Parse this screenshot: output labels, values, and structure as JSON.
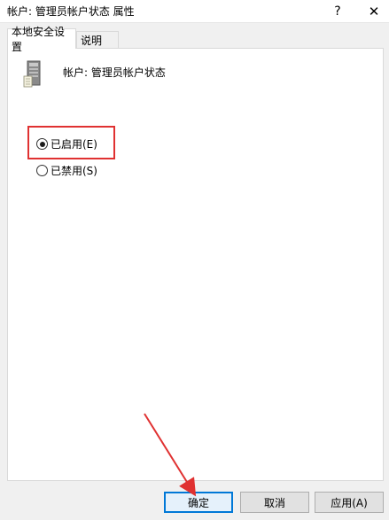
{
  "window": {
    "title": "帐户: 管理员帐户状态 属性",
    "help_label": "?",
    "close_label": "✕"
  },
  "tabs": [
    {
      "label": "本地安全设置",
      "active": true
    },
    {
      "label": "说明",
      "active": false
    }
  ],
  "policy": {
    "icon": "server-icon",
    "name": "帐户: 管理员帐户状态"
  },
  "options": [
    {
      "label": "已启用(E)",
      "checked": true
    },
    {
      "label": "已禁用(S)",
      "checked": false
    }
  ],
  "buttons": {
    "ok": "确定",
    "cancel": "取消",
    "apply": "应用(A)"
  },
  "colors": {
    "highlight": "#e03131",
    "primary_border": "#0078d7"
  }
}
